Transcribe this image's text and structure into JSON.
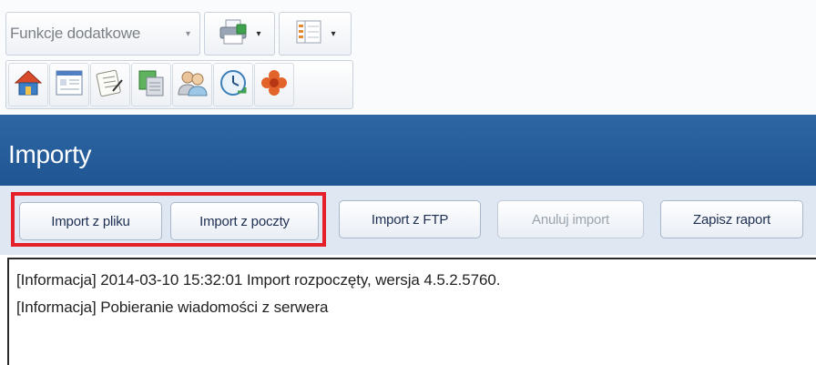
{
  "toolbar": {
    "dropdown_label": "Funkcje dodatkowe",
    "arrow": "▾",
    "print_icon": "printer-icon",
    "view_icon": "column-layout-icon",
    "icons": [
      "home-icon",
      "window-icon",
      "notepad-icon",
      "copy-icon",
      "users-icon",
      "clock-icon",
      "flower-icon"
    ]
  },
  "header": {
    "title": "Importy"
  },
  "buttons": {
    "import_file": "Import z pliku",
    "import_mail": "Import z poczty",
    "import_ftp": "Import z FTP",
    "cancel_import": "Anuluj import",
    "save_report": "Zapisz raport"
  },
  "log": {
    "lines": [
      "[Informacja] 2014-03-10 15:32:01 Import rozpoczęty, wersja 4.5.2.5760.",
      "[Informacja] Pobieranie wiadomości z serwera"
    ]
  },
  "colors": {
    "header_blue": "#2a61a0",
    "highlight_red": "#e6202b",
    "panel_bg": "#dfe7f2"
  }
}
